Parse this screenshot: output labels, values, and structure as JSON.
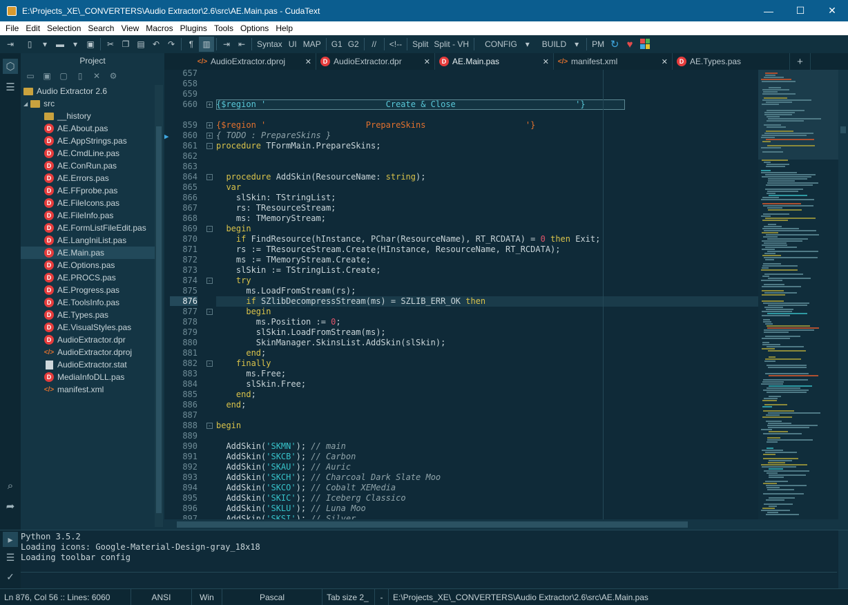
{
  "window": {
    "title": "E:\\Projects_XE\\_CONVERTERS\\Audio Extractor\\2.6\\src\\AE.Main.pas - CudaText",
    "minimize": "—",
    "maximize": "☐",
    "close": "✕"
  },
  "menu": [
    "File",
    "Edit",
    "Selection",
    "Search",
    "View",
    "Macros",
    "Plugins",
    "Tools",
    "Options",
    "Help"
  ],
  "toolbar": {
    "syntax": "Syntax",
    "ui": "UI",
    "map": "MAP",
    "g1": "G1",
    "g2": "G2",
    "comment": "//",
    "htmlcomment": "<!--",
    "split": "Split",
    "split_vh": "Split - VH",
    "config": "CONFIG",
    "build": "BUILD",
    "pm": "PM"
  },
  "panel": {
    "title": "Project",
    "tree": [
      {
        "label": "Audio Extractor 2.6",
        "type": "project",
        "depth": 0
      },
      {
        "label": "src",
        "type": "folder-open",
        "depth": 1
      },
      {
        "label": "__history",
        "type": "folder",
        "depth": 2
      },
      {
        "label": "AE.About.pas",
        "type": "pas",
        "depth": 2
      },
      {
        "label": "AE.AppStrings.pas",
        "type": "pas",
        "depth": 2
      },
      {
        "label": "AE.CmdLine.pas",
        "type": "pas",
        "depth": 2
      },
      {
        "label": "AE.ConRun.pas",
        "type": "pas",
        "depth": 2
      },
      {
        "label": "AE.Errors.pas",
        "type": "pas",
        "depth": 2
      },
      {
        "label": "AE.FFprobe.pas",
        "type": "pas",
        "depth": 2
      },
      {
        "label": "AE.FileIcons.pas",
        "type": "pas",
        "depth": 2
      },
      {
        "label": "AE.FileInfo.pas",
        "type": "pas",
        "depth": 2
      },
      {
        "label": "AE.FormListFileEdit.pas",
        "type": "pas",
        "depth": 2
      },
      {
        "label": "AE.LangIniList.pas",
        "type": "pas",
        "depth": 2
      },
      {
        "label": "AE.Main.pas",
        "type": "pas",
        "depth": 2,
        "selected": true
      },
      {
        "label": "AE.Options.pas",
        "type": "pas",
        "depth": 2
      },
      {
        "label": "AE.PROCS.pas",
        "type": "pas",
        "depth": 2
      },
      {
        "label": "AE.Progress.pas",
        "type": "pas",
        "depth": 2
      },
      {
        "label": "AE.ToolsInfo.pas",
        "type": "pas",
        "depth": 2
      },
      {
        "label": "AE.Types.pas",
        "type": "pas",
        "depth": 2
      },
      {
        "label": "AE.VisualStyles.pas",
        "type": "pas",
        "depth": 2
      },
      {
        "label": "AudioExtractor.dpr",
        "type": "pas",
        "depth": 2
      },
      {
        "label": "AudioExtractor.dproj",
        "type": "xml",
        "depth": 2
      },
      {
        "label": "AudioExtractor.stat",
        "type": "stat",
        "depth": 2
      },
      {
        "label": "MediaInfoDLL.pas",
        "type": "pas",
        "depth": 2
      },
      {
        "label": "manifest.xml",
        "type": "xml",
        "depth": 2
      }
    ]
  },
  "tabs": [
    {
      "label": "AudioExtractor.dproj",
      "icon": "xml"
    },
    {
      "label": "AudioExtractor.dpr",
      "icon": "pas"
    },
    {
      "label": "AE.Main.pas",
      "icon": "pas",
      "active": true
    },
    {
      "label": "manifest.xml",
      "icon": "xml"
    },
    {
      "label": "AE.Types.pas",
      "icon": "pas"
    }
  ],
  "new_tab": "+",
  "editor": {
    "current_line": "876",
    "lines": [
      {
        "n": "657",
        "html": ""
      },
      {
        "n": "658",
        "html": ""
      },
      {
        "n": "659",
        "html": ""
      },
      {
        "n": "660",
        "html": "<span class='rgb'>{$region '                        Create &amp; Close                        '}</span>",
        "fold": "+",
        "region": true
      },
      {
        "n": "",
        "html": ""
      },
      {
        "n": "859",
        "html": "<span class='rg'>{$region '                    PrepareSkins                    '}</span>",
        "fold": "+"
      },
      {
        "n": "860",
        "html": "<span class='c'>{ TODO : PrepareSkins }</span>",
        "fold": "+"
      },
      {
        "n": "861",
        "html": "<span class='k'>procedure</span> TFormMain.PrepareSkins;",
        "fold": "-"
      },
      {
        "n": "862",
        "html": ""
      },
      {
        "n": "863",
        "html": ""
      },
      {
        "n": "864",
        "html": "  <span class='k'>procedure</span> AddSkin(ResourceName: <span class='k'>string</span>);",
        "fold": "-"
      },
      {
        "n": "865",
        "html": "  <span class='k'>var</span>"
      },
      {
        "n": "866",
        "html": "    slSkin: TStringList;"
      },
      {
        "n": "867",
        "html": "    rs: TResourceStream;"
      },
      {
        "n": "868",
        "html": "    ms: TMemoryStream;"
      },
      {
        "n": "869",
        "html": "  <span class='k'>begin</span>",
        "fold": "-"
      },
      {
        "n": "870",
        "html": "    <span class='k'>if</span> FindResource(hInstance, PChar(ResourceName), RT_RCDATA) = <span class='n'>0</span> <span class='k'>then</span> Exit;"
      },
      {
        "n": "871",
        "html": "    rs := TResourceStream.Create(HInstance, ResourceName, RT_RCDATA);"
      },
      {
        "n": "872",
        "html": "    ms := TMemoryStream.Create;"
      },
      {
        "n": "873",
        "html": "    slSkin := TStringList.Create;"
      },
      {
        "n": "874",
        "html": "    <span class='k'>try</span>",
        "fold": "-"
      },
      {
        "n": "875",
        "html": "      ms.LoadFromStream(rs);"
      },
      {
        "n": "876",
        "html": "      <span class='k'>if</span> SZlibDecompressStream(ms) = SZLIB_ERR_OK <span class='k'>then</span>",
        "current": true
      },
      {
        "n": "877",
        "html": "      <span class='k'>begin</span>",
        "fold": "-"
      },
      {
        "n": "878",
        "html": "        ms.Position := <span class='n'>0</span>;"
      },
      {
        "n": "879",
        "html": "        slSkin.LoadFromStream(ms);"
      },
      {
        "n": "880",
        "html": "        SkinManager.SkinsList.AddSkin(slSkin);"
      },
      {
        "n": "881",
        "html": "      <span class='k'>end</span>;"
      },
      {
        "n": "882",
        "html": "    <span class='k'>finally</span>",
        "fold": "-"
      },
      {
        "n": "883",
        "html": "      ms.Free;"
      },
      {
        "n": "884",
        "html": "      slSkin.Free;"
      },
      {
        "n": "885",
        "html": "    <span class='k'>end</span>;"
      },
      {
        "n": "886",
        "html": "  <span class='k'>end</span>;"
      },
      {
        "n": "887",
        "html": ""
      },
      {
        "n": "888",
        "html": "<span class='k'>begin</span>",
        "fold": "-"
      },
      {
        "n": "889",
        "html": ""
      },
      {
        "n": "890",
        "html": "  AddSkin(<span class='s'>'SKMN'</span>); <span class='c'>// main</span>"
      },
      {
        "n": "891",
        "html": "  AddSkin(<span class='s'>'SKCB'</span>); <span class='c'>// Carbon</span>"
      },
      {
        "n": "892",
        "html": "  AddSkin(<span class='s'>'SKAU'</span>); <span class='c'>// Auric</span>"
      },
      {
        "n": "893",
        "html": "  AddSkin(<span class='s'>'SKCH'</span>); <span class='c'>// Charcoal Dark Slate Moo</span>"
      },
      {
        "n": "894",
        "html": "  AddSkin(<span class='s'>'SKCO'</span>); <span class='c'>// Cobalt XEMedia</span>"
      },
      {
        "n": "895",
        "html": "  AddSkin(<span class='s'>'SKIC'</span>); <span class='c'>// Iceberg Classico</span>"
      },
      {
        "n": "896",
        "html": "  AddSkin(<span class='s'>'SKLU'</span>); <span class='c'>// Luna Moo</span>"
      },
      {
        "n": "897",
        "html": "  AddSkin(<span class='s'>'SKSI'</span>); <span class='c'>// Silver</span>"
      }
    ]
  },
  "console": {
    "output": [
      "Python 3.5.2",
      "Loading icons: Google-Material-Design-gray_18x18",
      "Loading toolbar config"
    ]
  },
  "status": {
    "position": "Ln 876, Col 56 :: Lines: 6060",
    "encoding": "ANSI",
    "line_ending": "Win",
    "lexer": "Pascal",
    "tab_size": "Tab size 2_",
    "dash": "-",
    "path": "E:\\Projects_XE\\_CONVERTERS\\Audio Extractor\\2.6\\src\\AE.Main.pas"
  },
  "colors": {
    "titlebar": "#0b5d8f",
    "editor_bg": "#0f2a38",
    "keyword": "#d9c24a",
    "string": "#37c2c9",
    "region": "#e2712e",
    "pas_icon": "#e53c3c"
  }
}
